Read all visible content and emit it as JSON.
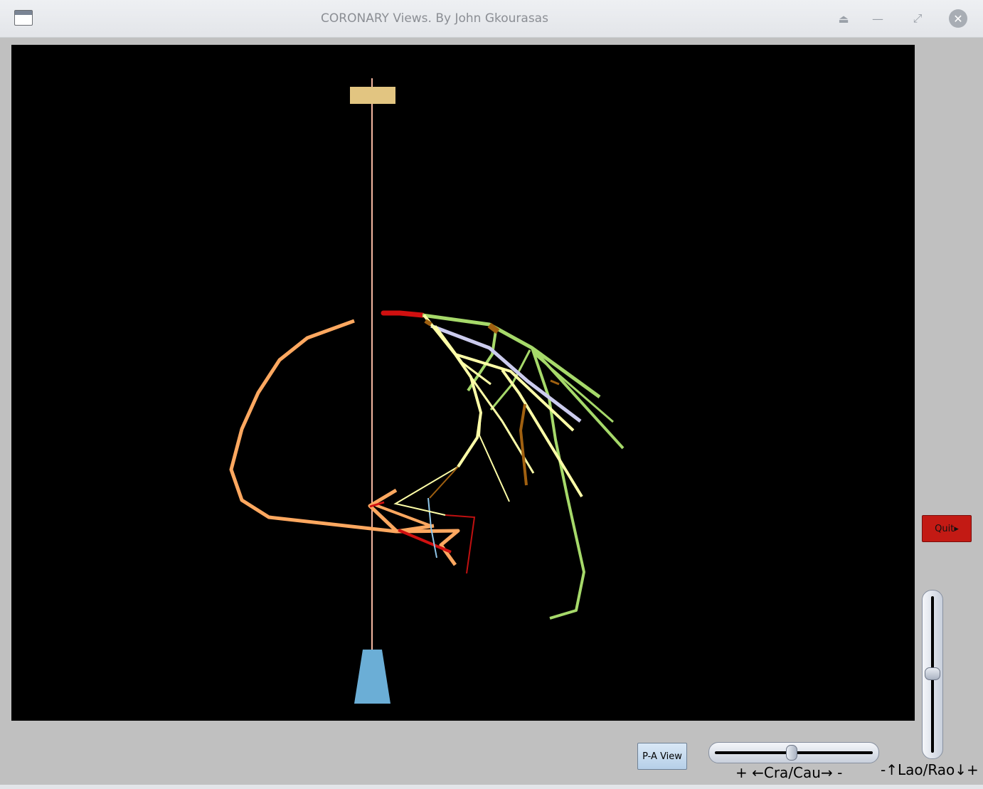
{
  "window": {
    "title": "CORONARY Views. By John Gkourasas",
    "icons": [
      "window-app-icon",
      "eject-icon",
      "minimize-icon",
      "maximize-icon",
      "close-icon"
    ]
  },
  "controls": {
    "pa_view_label": "P-A View",
    "quit_label": "Quit▸",
    "cra_cau_label": "+ ←Cra/Cau→ -",
    "lao_rao_label": "-↑Lao/Rao↓+",
    "cra_cau_value": 0.5,
    "lao_rao_value": 0.5
  },
  "colors": {
    "background": "#000000",
    "rca": "#ffa860",
    "lad": "#a6d96a",
    "diagonal": "#ffffa8",
    "circumflex": "#ccccee",
    "left_main": "#d01010",
    "septal": "#a06010",
    "catheter_tip": "#e2c581",
    "image_intensifier": "#6baed6"
  }
}
